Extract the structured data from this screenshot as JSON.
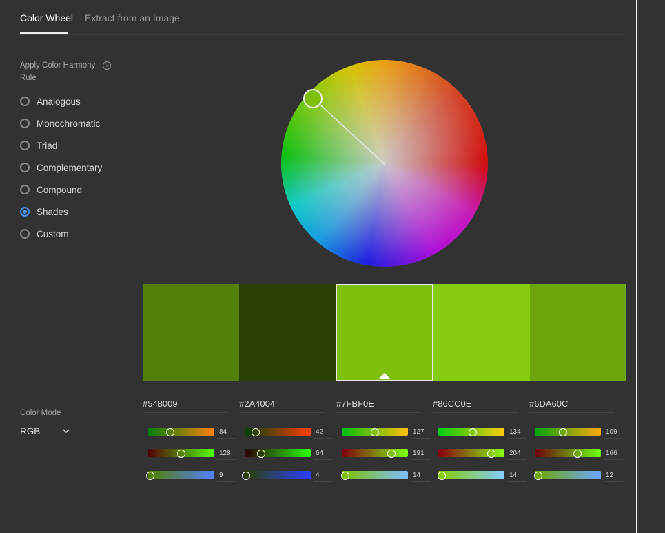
{
  "tabs": {
    "active": "Color Wheel",
    "inactive": "Extract from an Image"
  },
  "harmony": {
    "title": "Apply Color Harmony Rule",
    "help_icon": "help-circle-icon",
    "rules": [
      "Analogous",
      "Monochromatic",
      "Triad",
      "Complementary",
      "Compound",
      "Shades",
      "Custom"
    ],
    "selected": "Shades"
  },
  "color_mode": {
    "label": "Color Mode",
    "value": "RGB",
    "icon": "chevron-down-icon"
  },
  "swatches": [
    {
      "hex": "#548009",
      "r": 84,
      "g": 128,
      "b": 9
    },
    {
      "hex": "#2A4004",
      "r": 42,
      "g": 64,
      "b": 4
    },
    {
      "hex": "#7FBF0E",
      "r": 127,
      "g": 191,
      "b": 14
    },
    {
      "hex": "#86CC0E",
      "r": 134,
      "g": 204,
      "b": 14
    },
    {
      "hex": "#6DA60C",
      "r": 109,
      "g": 166,
      "b": 12
    }
  ],
  "active_swatch": 2
}
